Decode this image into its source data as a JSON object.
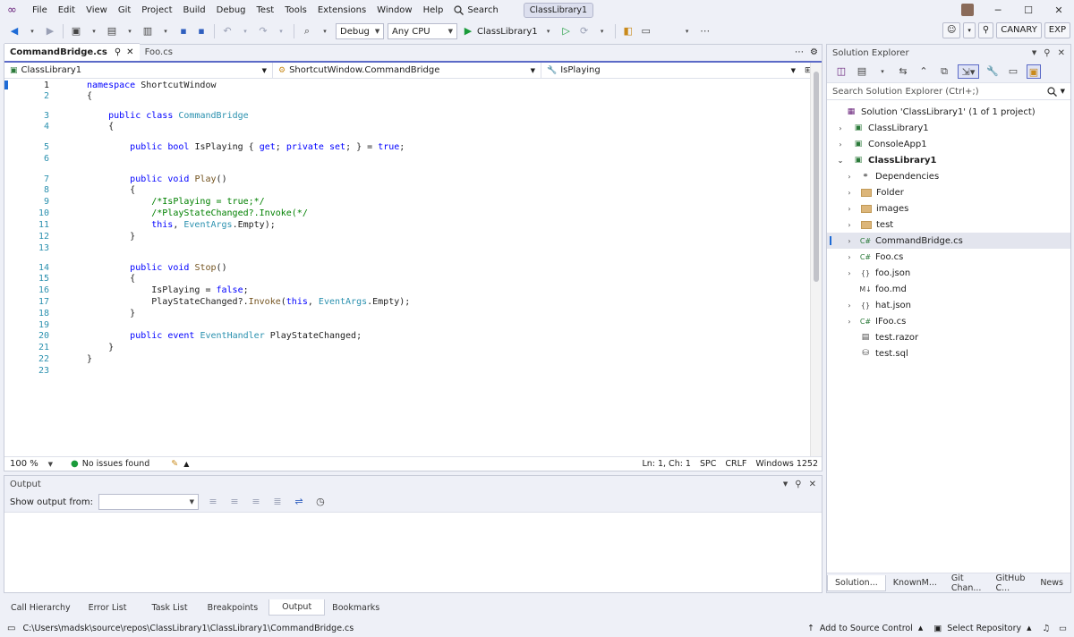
{
  "menu": [
    "File",
    "Edit",
    "View",
    "Git",
    "Project",
    "Build",
    "Debug",
    "Test",
    "Tools",
    "Extensions",
    "Window",
    "Help"
  ],
  "search_menu": "Search",
  "solution_title": "ClassLibrary1",
  "toolbar": {
    "config": "Debug",
    "platform": "Any CPU",
    "start_target": "ClassLibrary1",
    "canary": "CANARY",
    "exp": "EXP"
  },
  "editor": {
    "tabs": [
      {
        "label": "CommandBridge.cs",
        "active": true
      },
      {
        "label": "Foo.cs",
        "active": false
      }
    ],
    "nav": {
      "project": "ClassLibrary1",
      "type": "ShortcutWindow.CommandBridge",
      "member": "IsPlaying"
    },
    "line_numbers": [
      "1",
      "2",
      "3",
      "4",
      "5",
      "6",
      "7",
      "8",
      "9",
      "10",
      "11",
      "12",
      "13",
      "14",
      "15",
      "16",
      "17",
      "18",
      "19",
      "20",
      "21",
      "22",
      "23"
    ],
    "status": {
      "zoom": "100 %",
      "issues": "No issues found",
      "position": "Ln: 1, Ch: 1",
      "spc": "SPC",
      "crlf": "CRLF",
      "encoding": "Windows 1252"
    }
  },
  "output": {
    "title": "Output",
    "show_label": "Show output from:"
  },
  "bottom_tabs": [
    "Call Hierarchy",
    "Error List",
    "Task List",
    "Breakpoints",
    "Output",
    "Bookmarks"
  ],
  "solution_explorer": {
    "title": "Solution Explorer",
    "search_placeholder": "Search Solution Explorer (Ctrl+;)",
    "items": [
      {
        "label": "Solution 'ClassLibrary1' (1 of 1 project)",
        "icon": "solution-icon"
      },
      {
        "label": "ClassLibrary1",
        "icon": "project-icon"
      },
      {
        "label": "ConsoleApp1",
        "icon": "project-icon"
      },
      {
        "label": "ClassLibrary1",
        "icon": "project-icon"
      },
      {
        "label": "Dependencies",
        "icon": "dependencies-icon"
      },
      {
        "label": "Folder",
        "icon": "folder-icon"
      },
      {
        "label": "images",
        "icon": "folder-icon"
      },
      {
        "label": "test",
        "icon": "folder-icon"
      },
      {
        "label": "CommandBridge.cs",
        "icon": "csharp-icon"
      },
      {
        "label": "Foo.cs",
        "icon": "csharp-icon"
      },
      {
        "label": "foo.json",
        "icon": "json-icon"
      },
      {
        "label": "foo.md",
        "icon": "markdown-icon"
      },
      {
        "label": "hat.json",
        "icon": "json-icon"
      },
      {
        "label": "IFoo.cs",
        "icon": "csharp-icon"
      },
      {
        "label": "test.razor",
        "icon": "razor-icon"
      },
      {
        "label": "test.sql",
        "icon": "sql-icon"
      }
    ],
    "bottom_tabs": [
      "Solution...",
      "KnownM...",
      "Git Chan...",
      "GitHub C...",
      "News"
    ]
  },
  "statusbar": {
    "path": "C:\\Users\\madsk\\source\\repos\\ClassLibrary1\\ClassLibrary1\\CommandBridge.cs",
    "source_control": "Add to Source Control",
    "repo": "Select Repository"
  }
}
